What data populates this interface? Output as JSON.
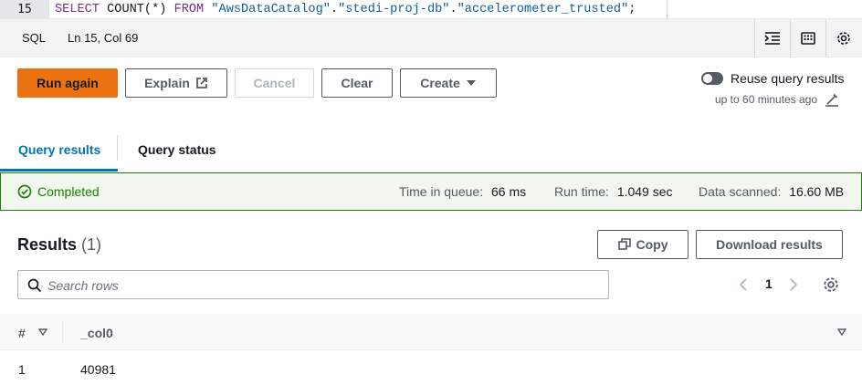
{
  "editor": {
    "line_number": "15",
    "query_keyword_select": "SELECT",
    "query_func": "COUNT(*)",
    "query_keyword_from": "FROM",
    "query_db": "\"AwsDataCatalog\"",
    "query_schema": "\"stedi-proj-db\"",
    "query_table": "\"accelerometer_trusted\"",
    "query_end": ";"
  },
  "statusbar": {
    "language": "SQL",
    "position": "Ln 15, Col 69",
    "icons": [
      "indent-icon",
      "keyboard-icon",
      "settings-icon"
    ]
  },
  "toolbar": {
    "run_again": "Run again",
    "explain": "Explain",
    "cancel": "Cancel",
    "clear": "Clear",
    "create": "Create",
    "reuse_label": "Reuse query results",
    "reuse_sub": "up to 60 minutes ago",
    "reuse_enabled": false
  },
  "tabs": [
    {
      "label": "Query results",
      "active": true
    },
    {
      "label": "Query status",
      "active": false
    }
  ],
  "run_status": {
    "status": "Completed",
    "queue_label": "Time in queue:",
    "queue_value": "66 ms",
    "runtime_label": "Run time:",
    "runtime_value": "1.049 sec",
    "scanned_label": "Data scanned:",
    "scanned_value": "16.60 MB"
  },
  "results": {
    "title": "Results",
    "count": "(1)",
    "copy": "Copy",
    "download": "Download results",
    "search_placeholder": "Search rows",
    "page": "1",
    "columns": [
      "#",
      "_col0"
    ],
    "rows": [
      {
        "index": "1",
        "col0": "40981"
      }
    ]
  },
  "colors": {
    "primary": "#ec7211",
    "link": "#0073bb",
    "success": "#1d8102"
  }
}
